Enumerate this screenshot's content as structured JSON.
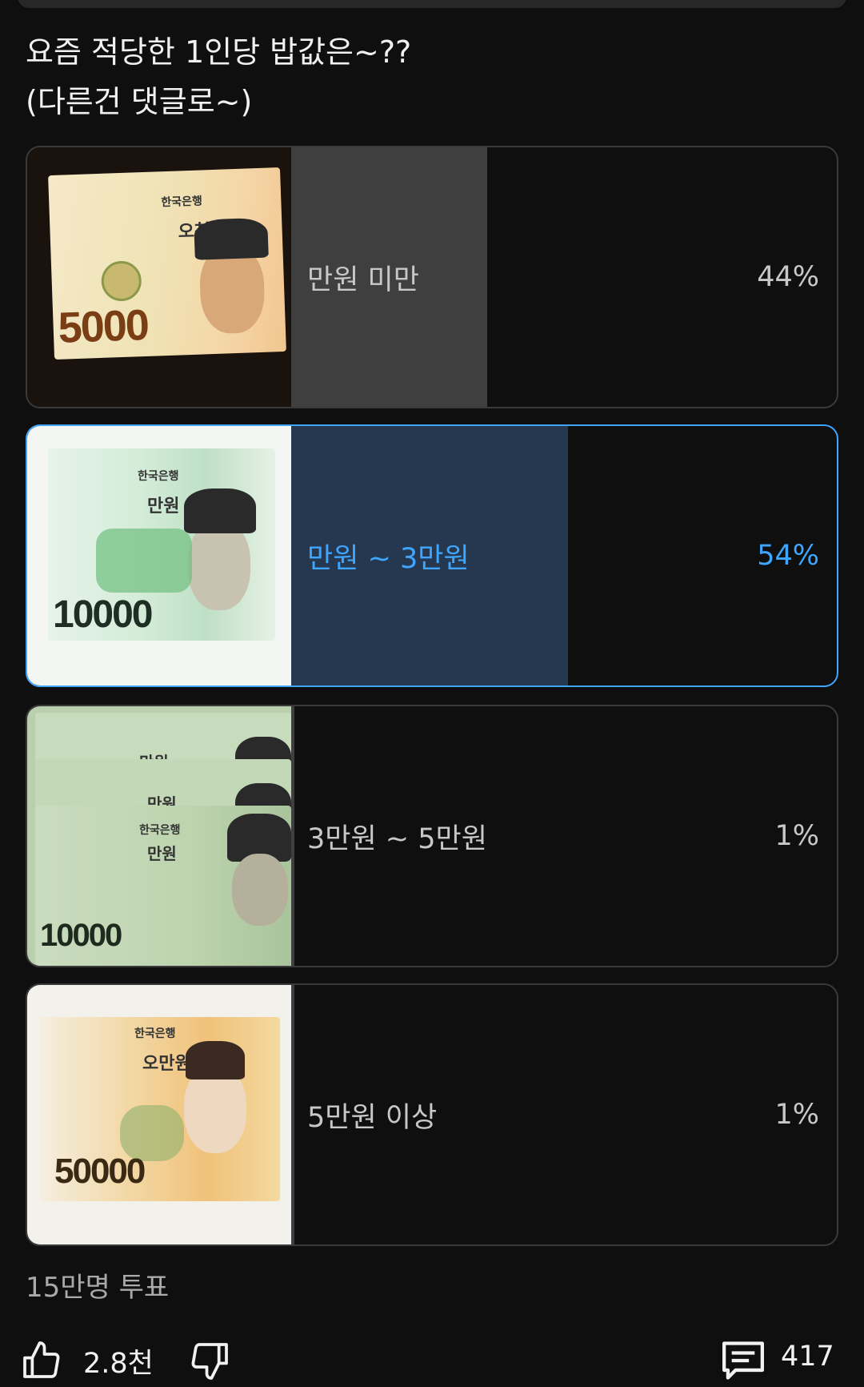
{
  "poll": {
    "question_line1": "요즘 적당한 1인당 밥값은~??",
    "question_line2": "(다른건 댓글로~)",
    "options": [
      {
        "label": "만원 미만",
        "percent_text": "44%",
        "percent": 44,
        "selected": false
      },
      {
        "label": "만원 ~ 3만원",
        "percent_text": "54%",
        "percent": 54,
        "selected": true
      },
      {
        "label": "3만원 ~ 5만원",
        "percent_text": "1%",
        "percent": 1,
        "selected": false
      },
      {
        "label": "5만원 이상",
        "percent_text": "1%",
        "percent": 1,
        "selected": false
      }
    ],
    "vote_count": "15만명 투표"
  },
  "notes": {
    "note1": {
      "name": "오천원",
      "number": "5000",
      "bank": "한국은행"
    },
    "note2": {
      "name": "만원",
      "number": "10000",
      "bank": "한국은행"
    },
    "note3": {
      "name": "만원",
      "number": "10000",
      "bank": "한국은행"
    },
    "note4": {
      "name": "오만원",
      "number": "50000",
      "bank": "한국은행"
    }
  },
  "actions": {
    "like_count": "2.8천",
    "comment_count": "417"
  },
  "colors": {
    "accent": "#3ea6ff",
    "bar": "#3f3f3f",
    "bar_selected": "#263850",
    "background": "#0f0f0f"
  },
  "icons": [
    "thumbs-up-icon",
    "thumbs-down-icon",
    "comment-icon"
  ]
}
